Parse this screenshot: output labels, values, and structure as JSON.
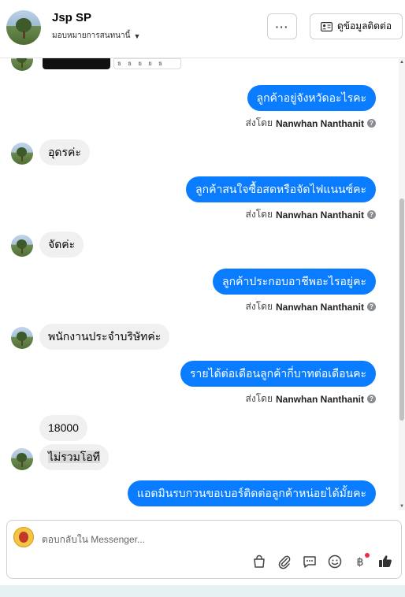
{
  "header": {
    "title": "Jsp SP",
    "subtitle": "มอบหมายการสนทนานี้",
    "more_label": "···",
    "contact_label": "ดูข้อมูลติดต่อ"
  },
  "messages": [
    {
      "dir": "out",
      "text": "ลูกค้าอยู่จังหวัดอะไรคะ",
      "sent_by_prefix": "ส่งโดย",
      "sent_by_name": "Nanwhan Nanthanit"
    },
    {
      "dir": "in",
      "text": "อุดรค่ะ"
    },
    {
      "dir": "out",
      "text": "ลูกค้าสนใจซื้อสดหรือจัดไฟแนนซ์คะ",
      "sent_by_prefix": "ส่งโดย",
      "sent_by_name": "Nanwhan Nanthanit"
    },
    {
      "dir": "in",
      "text": "จัดค่ะ"
    },
    {
      "dir": "out",
      "text": "ลูกค้าประกอบอาชีพอะไรอยู่คะ",
      "sent_by_prefix": "ส่งโดย",
      "sent_by_name": "Nanwhan Nanthanit"
    },
    {
      "dir": "in",
      "text": "พนักงานประจำบริษัทค่ะ"
    },
    {
      "dir": "out",
      "text": "รายได้ต่อเดือนลูกค้ากี่บาทต่อเดือนคะ",
      "sent_by_prefix": "ส่งโดย",
      "sent_by_name": "Nanwhan Nanthanit"
    },
    {
      "dir": "in",
      "text": "18000"
    },
    {
      "dir": "in",
      "text": "ไม่รวมโอที"
    },
    {
      "dir": "out",
      "text": "แอดมินรบกวนขอเบอร์ติดต่อลูกค้าหน่อยได้มั้ยคะ"
    }
  ],
  "composer": {
    "placeholder": "ตอบกลับใน Messenger..."
  },
  "tool_icons": [
    "bag-icon",
    "paperclip-icon",
    "saved-reply-icon",
    "emoji-icon",
    "baht-icon",
    "like-icon"
  ]
}
